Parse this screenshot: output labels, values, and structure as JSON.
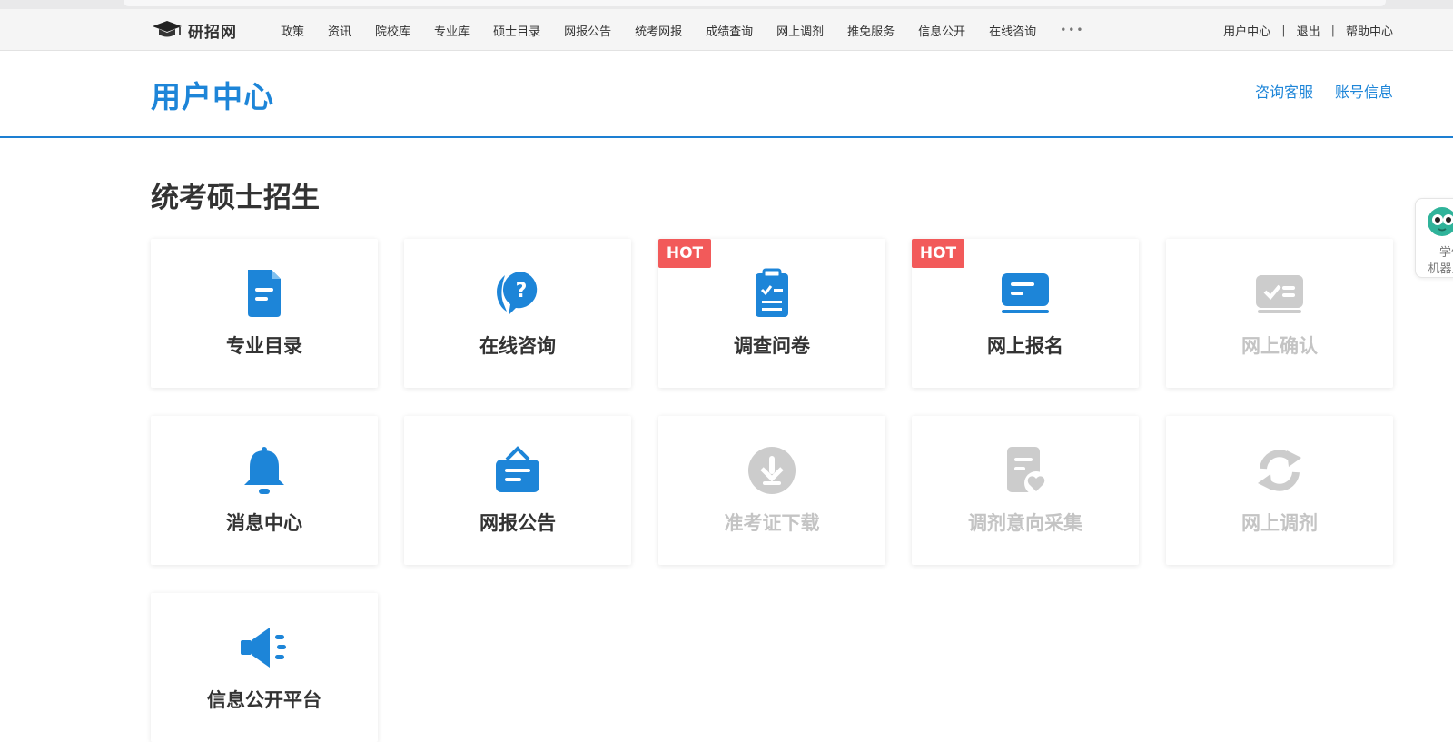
{
  "nav": {
    "logo_text": "研招网",
    "items": [
      "政策",
      "资讯",
      "院校库",
      "专业库",
      "硕士目录",
      "网报公告",
      "统考网报",
      "成绩查询",
      "网上调剂",
      "推免服务",
      "信息公开",
      "在线咨询"
    ],
    "more": "•••",
    "user_links": [
      "用户中心",
      "退出",
      "帮助中心"
    ],
    "separator": "|"
  },
  "header": {
    "title": "用户中心",
    "links": [
      "咨询客服",
      "账号信息"
    ]
  },
  "section_title": "统考硕士招生",
  "cards": [
    {
      "label": "专业目录",
      "icon": "document-icon",
      "enabled": true,
      "hot": false
    },
    {
      "label": "在线咨询",
      "icon": "question-chat-icon",
      "enabled": true,
      "hot": false
    },
    {
      "label": "调查问卷",
      "icon": "clipboard-check-icon",
      "enabled": true,
      "hot": true
    },
    {
      "label": "网上报名",
      "icon": "monitor-form-icon",
      "enabled": true,
      "hot": true
    },
    {
      "label": "网上确认",
      "icon": "check-card-icon",
      "enabled": false,
      "hot": false
    },
    {
      "label": "消息中心",
      "icon": "bell-icon",
      "enabled": true,
      "hot": false
    },
    {
      "label": "网报公告",
      "icon": "notice-board-icon",
      "enabled": true,
      "hot": false
    },
    {
      "label": "准考证下载",
      "icon": "download-circle-icon",
      "enabled": false,
      "hot": false
    },
    {
      "label": "调剂意向采集",
      "icon": "document-heart-icon",
      "enabled": false,
      "hot": false
    },
    {
      "label": "网上调剂",
      "icon": "refresh-icon",
      "enabled": false,
      "hot": false
    },
    {
      "label": "信息公开平台",
      "icon": "megaphone-icon",
      "enabled": true,
      "hot": false
    }
  ],
  "hot_label": "HOT",
  "robot": {
    "line1": "学信",
    "line2": "机器人"
  },
  "colors": {
    "brand_blue": "#1d85d8",
    "hot_red": "#f25a5a",
    "disabled_gray": "#cccccc"
  }
}
